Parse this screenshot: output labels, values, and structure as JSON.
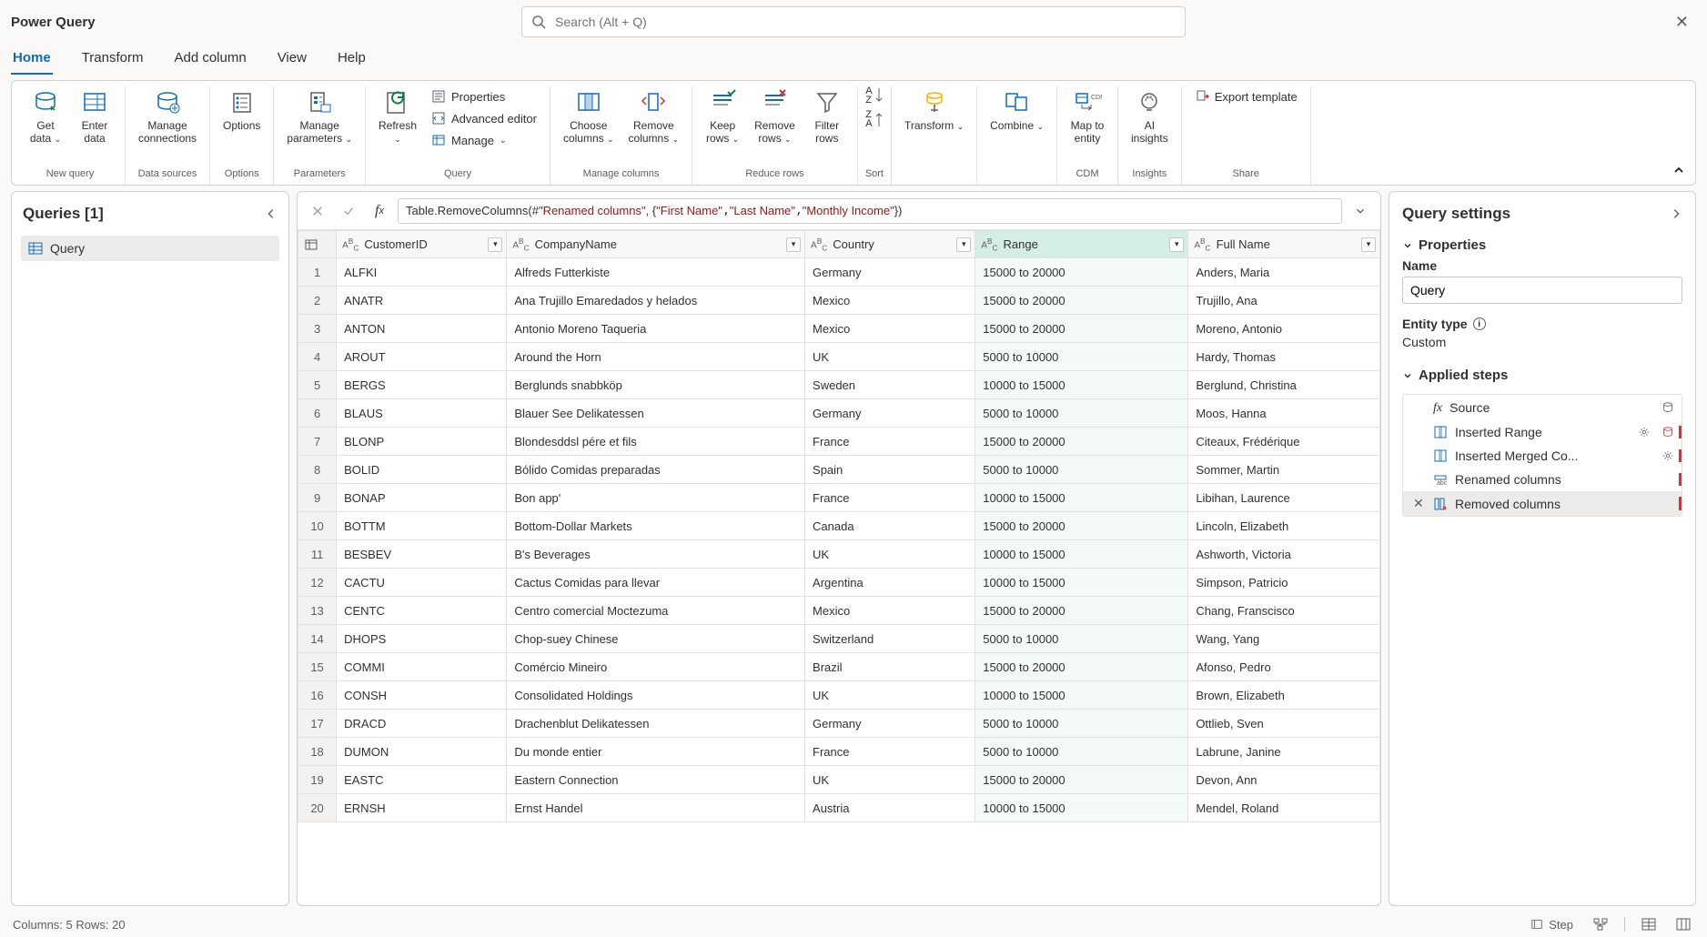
{
  "app_title": "Power Query",
  "search_placeholder": "Search (Alt + Q)",
  "tabs": [
    "Home",
    "Transform",
    "Add column",
    "View",
    "Help"
  ],
  "active_tab": 0,
  "ribbon": {
    "groups": [
      {
        "label": "New query",
        "items": [
          {
            "label": "Get\ndata",
            "dropdown": true
          },
          {
            "label": "Enter\ndata"
          }
        ]
      },
      {
        "label": "Data sources",
        "items": [
          {
            "label": "Manage\nconnections"
          }
        ]
      },
      {
        "label": "Options",
        "items": [
          {
            "label": "Options"
          }
        ]
      },
      {
        "label": "Parameters",
        "items": [
          {
            "label": "Manage\nparameters",
            "dropdown": true
          }
        ]
      },
      {
        "label": "Query",
        "big": [
          {
            "label": "Refresh",
            "dropdown": true
          }
        ],
        "small": [
          "Properties",
          "Advanced editor",
          "Manage"
        ]
      },
      {
        "label": "Manage columns",
        "items": [
          {
            "label": "Choose\ncolumns",
            "dropdown": true
          },
          {
            "label": "Remove\ncolumns",
            "dropdown": true
          }
        ]
      },
      {
        "label": "Reduce rows",
        "items": [
          {
            "label": "Keep\nrows",
            "dropdown": true
          },
          {
            "label": "Remove\nrows",
            "dropdown": true
          },
          {
            "label": "Filter\nrows"
          }
        ]
      },
      {
        "label": "Sort",
        "items": []
      },
      {
        "label": "",
        "items": [
          {
            "label": "Transform",
            "dropdown": true
          }
        ]
      },
      {
        "label": "",
        "items": [
          {
            "label": "Combine",
            "dropdown": true
          }
        ]
      },
      {
        "label": "CDM",
        "items": [
          {
            "label": "Map to\nentity"
          }
        ]
      },
      {
        "label": "Insights",
        "items": [
          {
            "label": "AI\ninsights"
          }
        ]
      },
      {
        "label": "Share",
        "small_only": [
          "Export template"
        ]
      }
    ]
  },
  "queries": {
    "title": "Queries [1]",
    "items": [
      "Query"
    ]
  },
  "formula": {
    "prefix": "Table.RemoveColumns(#",
    "arg1": "\"Renamed columns\"",
    "mid": ", {",
    "s1": "\"First Name\"",
    "s2": "\"Last Name\"",
    "s3": "\"Monthly Income\"",
    "suffix": "})"
  },
  "columns": [
    "CustomerID",
    "CompanyName",
    "Country",
    "Range",
    "Full Name"
  ],
  "selected_column_index": 3,
  "rows": [
    [
      "ALFKI",
      "Alfreds Futterkiste",
      "Germany",
      "15000 to 20000",
      "Anders, Maria"
    ],
    [
      "ANATR",
      "Ana Trujillo Emaredados y helados",
      "Mexico",
      "15000 to 20000",
      "Trujillo, Ana"
    ],
    [
      "ANTON",
      "Antonio Moreno Taqueria",
      "Mexico",
      "15000 to 20000",
      "Moreno, Antonio"
    ],
    [
      "AROUT",
      "Around the Horn",
      "UK",
      "5000 to 10000",
      "Hardy, Thomas"
    ],
    [
      "BERGS",
      "Berglunds snabbköp",
      "Sweden",
      "10000 to 15000",
      "Berglund, Christina"
    ],
    [
      "BLAUS",
      "Blauer See Delikatessen",
      "Germany",
      "5000 to 10000",
      "Moos, Hanna"
    ],
    [
      "BLONP",
      "Blondesddsl pére et fils",
      "France",
      "15000 to 20000",
      "Citeaux, Frédérique"
    ],
    [
      "BOLID",
      "Bólido Comidas preparadas",
      "Spain",
      "5000 to 10000",
      "Sommer, Martin"
    ],
    [
      "BONAP",
      "Bon app'",
      "France",
      "10000 to 15000",
      "Libihan, Laurence"
    ],
    [
      "BOTTM",
      "Bottom-Dollar Markets",
      "Canada",
      "15000 to 20000",
      "Lincoln, Elizabeth"
    ],
    [
      "BESBEV",
      "B's Beverages",
      "UK",
      "10000 to 15000",
      "Ashworth, Victoria"
    ],
    [
      "CACTU",
      "Cactus Comidas para llevar",
      "Argentina",
      "10000 to 15000",
      "Simpson, Patricio"
    ],
    [
      "CENTC",
      "Centro comercial Moctezuma",
      "Mexico",
      "15000 to 20000",
      "Chang, Franscisco"
    ],
    [
      "DHOPS",
      "Chop-suey Chinese",
      "Switzerland",
      "5000 to 10000",
      "Wang, Yang"
    ],
    [
      "COMMI",
      "Comércio Mineiro",
      "Brazil",
      "15000 to 20000",
      "Afonso, Pedro"
    ],
    [
      "CONSH",
      "Consolidated Holdings",
      "UK",
      "10000 to 15000",
      "Brown, Elizabeth"
    ],
    [
      "DRACD",
      "Drachenblut Delikatessen",
      "Germany",
      "5000 to 10000",
      "Ottlieb, Sven"
    ],
    [
      "DUMON",
      "Du monde entier",
      "France",
      "5000 to 10000",
      "Labrune, Janine"
    ],
    [
      "EASTC",
      "Eastern Connection",
      "UK",
      "15000 to 20000",
      "Devon, Ann"
    ],
    [
      "ERNSH",
      "Ernst Handel",
      "Austria",
      "10000 to 15000",
      "Mendel, Roland"
    ]
  ],
  "settings": {
    "title": "Query settings",
    "properties_label": "Properties",
    "name_label": "Name",
    "name_value": "Query",
    "entity_type_label": "Entity type",
    "entity_type_value": "Custom",
    "applied_steps_label": "Applied steps",
    "steps": [
      {
        "label": "Source",
        "gear": false,
        "db": true
      },
      {
        "label": "Inserted Range",
        "gear": true,
        "marker": true,
        "db": true
      },
      {
        "label": "Inserted Merged Co...",
        "gear": true,
        "marker": true
      },
      {
        "label": "Renamed columns",
        "marker": true
      },
      {
        "label": "Removed columns",
        "selected": true,
        "marker": true,
        "delete": true
      }
    ]
  },
  "status": {
    "left": "Columns: 5   Rows: 20",
    "step_label": "Step"
  }
}
